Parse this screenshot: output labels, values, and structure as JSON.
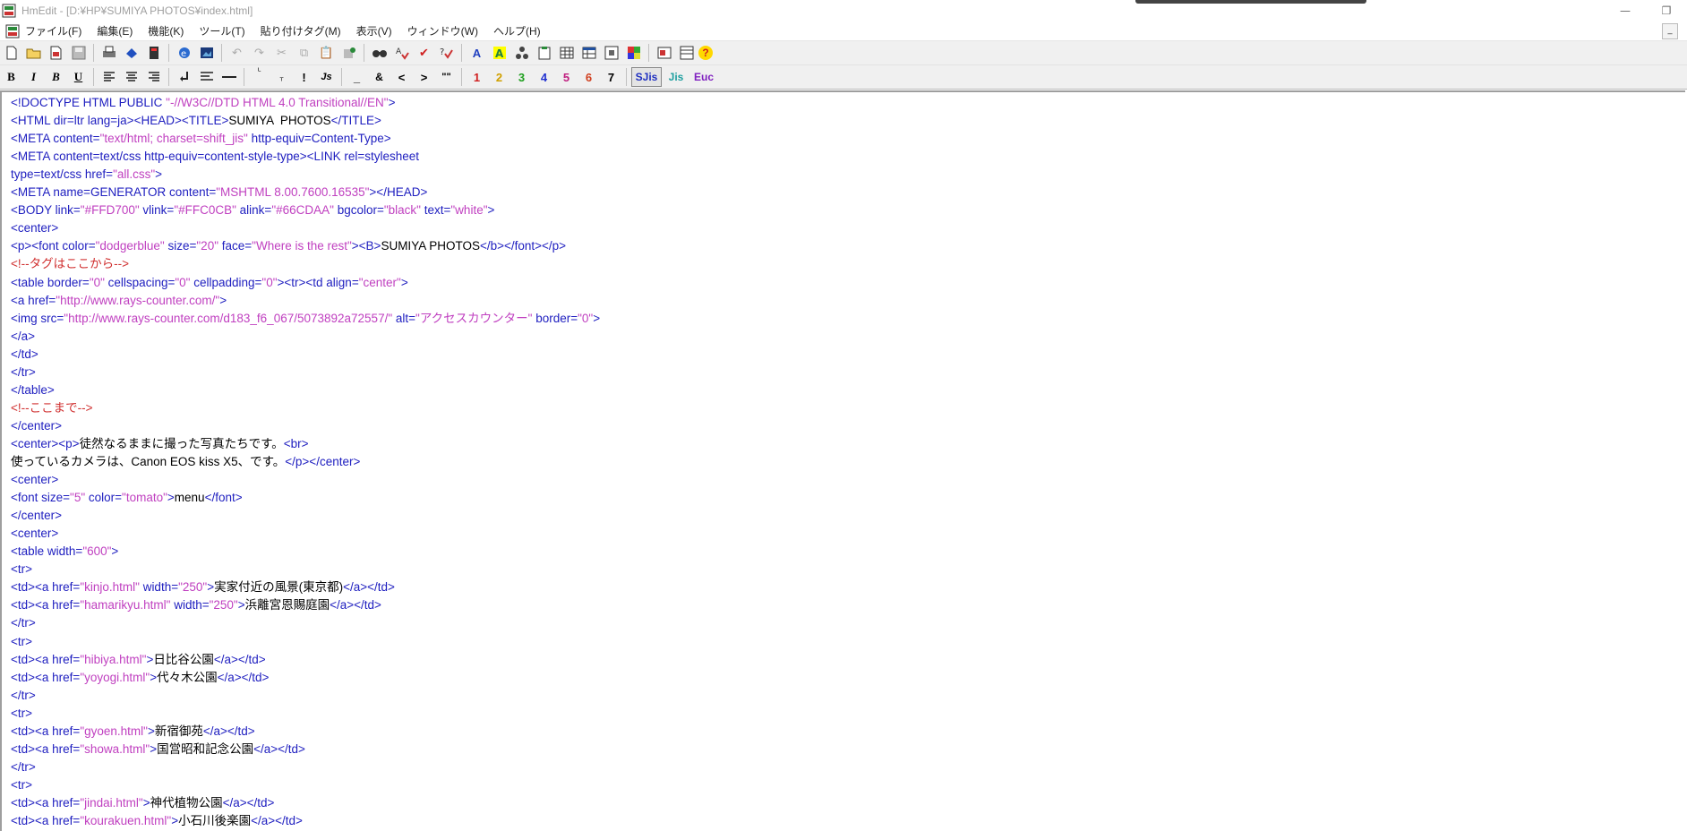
{
  "window": {
    "title": "HmEdit - [D:¥HP¥SUMIYA PHOTOS¥index.html]",
    "minimize": "—",
    "restore": "❐"
  },
  "menu": [
    "ファイル(F)",
    "編集(E)",
    "機能(K)",
    "ツール(T)",
    "貼り付けタグ(M)",
    "表示(V)",
    "ウィンドウ(W)",
    "ヘルプ(H)"
  ],
  "toolbar2": {
    "bold": "B",
    "italic": "I",
    "bold_italic": "B",
    "underline": "U",
    "js": "Js",
    "underscore": "_",
    "amp": "&",
    "lt": "<",
    "gt": ">",
    "quotes": "\"\"",
    "sizes": [
      "1",
      "2",
      "3",
      "4",
      "5",
      "6",
      "7"
    ],
    "encodings": [
      "SJis",
      "Jis",
      "Euc"
    ]
  },
  "colors": {
    "tag": "#2020c0",
    "string": "#c040c0",
    "comment": "#d03030",
    "size_colors": [
      "#d02020",
      "#d0a000",
      "#20a020",
      "#2030d0",
      "#c02080",
      "#d04020",
      "#000000"
    ]
  },
  "code_lines": [
    [
      {
        "t": "tag",
        "v": "<!DOCTYPE HTML PUBLIC "
      },
      {
        "t": "str",
        "v": "\"-//W3C//DTD HTML 4.0 Transitional//EN\""
      },
      {
        "t": "tag",
        "v": ">"
      }
    ],
    [
      {
        "t": "tag",
        "v": "<HTML dir=ltr lang=ja><HEAD><TITLE>"
      },
      {
        "t": "txt",
        "v": "SUMIYA  PHOTOS"
      },
      {
        "t": "tag",
        "v": "</TITLE>"
      }
    ],
    [
      {
        "t": "tag",
        "v": "<META content="
      },
      {
        "t": "str",
        "v": "\"text/html; charset=shift_jis\""
      },
      {
        "t": "tag",
        "v": " http-equiv=Content-Type>"
      }
    ],
    [
      {
        "t": "tag",
        "v": "<META content=text/css http-equiv=content-style-type><LINK rel=stylesheet"
      }
    ],
    [
      {
        "t": "tag",
        "v": "type=text/css href="
      },
      {
        "t": "str",
        "v": "\"all.css\""
      },
      {
        "t": "tag",
        "v": ">"
      }
    ],
    [
      {
        "t": "tag",
        "v": "<META name=GENERATOR content="
      },
      {
        "t": "str",
        "v": "\"MSHTML 8.00.7600.16535\""
      },
      {
        "t": "tag",
        "v": "></HEAD>"
      }
    ],
    [
      {
        "t": "tag",
        "v": "<BODY link="
      },
      {
        "t": "str",
        "v": "\"#FFD700\""
      },
      {
        "t": "tag",
        "v": " vlink="
      },
      {
        "t": "str",
        "v": "\"#FFC0CB\""
      },
      {
        "t": "tag",
        "v": " alink="
      },
      {
        "t": "str",
        "v": "\"#66CDAA\""
      },
      {
        "t": "tag",
        "v": " bgcolor="
      },
      {
        "t": "str",
        "v": "\"black\""
      },
      {
        "t": "tag",
        "v": " text="
      },
      {
        "t": "str",
        "v": "\"white\""
      },
      {
        "t": "tag",
        "v": ">"
      }
    ],
    [
      {
        "t": "tag",
        "v": "<center>"
      }
    ],
    [
      {
        "t": "tag",
        "v": "<p><font color="
      },
      {
        "t": "str",
        "v": "\"dodgerblue\""
      },
      {
        "t": "tag",
        "v": " size="
      },
      {
        "t": "str",
        "v": "\"20\""
      },
      {
        "t": "tag",
        "v": " face="
      },
      {
        "t": "str",
        "v": "\"Where is the rest\""
      },
      {
        "t": "tag",
        "v": "><B>"
      },
      {
        "t": "txt",
        "v": "SUMIYA PHOTOS"
      },
      {
        "t": "tag",
        "v": "</b></font></p>"
      }
    ],
    [
      {
        "t": "cmt",
        "v": "<!--タグはここから-->"
      }
    ],
    [
      {
        "t": "tag",
        "v": "<table border="
      },
      {
        "t": "str",
        "v": "\"0\""
      },
      {
        "t": "tag",
        "v": " cellspacing="
      },
      {
        "t": "str",
        "v": "\"0\""
      },
      {
        "t": "tag",
        "v": " cellpadding="
      },
      {
        "t": "str",
        "v": "\"0\""
      },
      {
        "t": "tag",
        "v": "><tr><td align="
      },
      {
        "t": "str",
        "v": "\"center\""
      },
      {
        "t": "tag",
        "v": ">"
      }
    ],
    [
      {
        "t": "tag",
        "v": "<a href="
      },
      {
        "t": "str",
        "v": "\"http://www.rays-counter.com/\""
      },
      {
        "t": "tag",
        "v": ">"
      }
    ],
    [
      {
        "t": "tag",
        "v": "<img src="
      },
      {
        "t": "str",
        "v": "\"http://www.rays-counter.com/d183_f6_067/5073892a72557/\""
      },
      {
        "t": "tag",
        "v": " alt="
      },
      {
        "t": "str",
        "v": "\"アクセスカウンター\""
      },
      {
        "t": "tag",
        "v": " border="
      },
      {
        "t": "str",
        "v": "\"0\""
      },
      {
        "t": "tag",
        "v": ">"
      }
    ],
    [
      {
        "t": "tag",
        "v": "</a>"
      }
    ],
    [
      {
        "t": "tag",
        "v": "</td>"
      }
    ],
    [
      {
        "t": "tag",
        "v": "</tr>"
      }
    ],
    [
      {
        "t": "tag",
        "v": "</table>"
      }
    ],
    [
      {
        "t": "cmt",
        "v": "<!--ここまで-->"
      }
    ],
    [
      {
        "t": "tag",
        "v": "</center>"
      }
    ],
    [
      {
        "t": "tag",
        "v": "<center><p>"
      },
      {
        "t": "txt",
        "v": "徒然なるままに撮った写真たちです。"
      },
      {
        "t": "tag",
        "v": "<br>"
      }
    ],
    [
      {
        "t": "txt",
        "v": "使っているカメラは、Canon EOS kiss X5、です。"
      },
      {
        "t": "tag",
        "v": "</p></center>"
      }
    ],
    [
      {
        "t": "tag",
        "v": "<center>"
      }
    ],
    [
      {
        "t": "tag",
        "v": "<font size="
      },
      {
        "t": "str",
        "v": "\"5\""
      },
      {
        "t": "tag",
        "v": " color="
      },
      {
        "t": "str",
        "v": "\"tomato\""
      },
      {
        "t": "tag",
        "v": ">"
      },
      {
        "t": "txt",
        "v": "menu"
      },
      {
        "t": "tag",
        "v": "</font>"
      }
    ],
    [
      {
        "t": "tag",
        "v": "</center>"
      }
    ],
    [
      {
        "t": "tag",
        "v": "<center>"
      }
    ],
    [
      {
        "t": "tag",
        "v": "<table width="
      },
      {
        "t": "str",
        "v": "\"600\""
      },
      {
        "t": "tag",
        "v": ">"
      }
    ],
    [
      {
        "t": "tag",
        "v": "<tr>"
      }
    ],
    [
      {
        "t": "tag",
        "v": "<td><a href="
      },
      {
        "t": "str",
        "v": "\"kinjo.html\""
      },
      {
        "t": "tag",
        "v": " width="
      },
      {
        "t": "str",
        "v": "\"250\""
      },
      {
        "t": "tag",
        "v": ">"
      },
      {
        "t": "txt",
        "v": "実家付近の風景(東京都)"
      },
      {
        "t": "tag",
        "v": "</a></td>"
      }
    ],
    [
      {
        "t": "tag",
        "v": "<td><a href="
      },
      {
        "t": "str",
        "v": "\"hamarikyu.html\""
      },
      {
        "t": "tag",
        "v": " width="
      },
      {
        "t": "str",
        "v": "\"250\""
      },
      {
        "t": "tag",
        "v": ">"
      },
      {
        "t": "txt",
        "v": "浜離宮恩賜庭園"
      },
      {
        "t": "tag",
        "v": "</a></td>"
      }
    ],
    [
      {
        "t": "tag",
        "v": "</tr>"
      }
    ],
    [
      {
        "t": "tag",
        "v": "<tr>"
      }
    ],
    [
      {
        "t": "tag",
        "v": "<td><a href="
      },
      {
        "t": "str",
        "v": "\"hibiya.html\""
      },
      {
        "t": "tag",
        "v": ">"
      },
      {
        "t": "txt",
        "v": "日比谷公園"
      },
      {
        "t": "tag",
        "v": "</a></td>"
      }
    ],
    [
      {
        "t": "tag",
        "v": "<td><a href="
      },
      {
        "t": "str",
        "v": "\"yoyogi.html\""
      },
      {
        "t": "tag",
        "v": ">"
      },
      {
        "t": "txt",
        "v": "代々木公園"
      },
      {
        "t": "tag",
        "v": "</a></td>"
      }
    ],
    [
      {
        "t": "tag",
        "v": "</tr>"
      }
    ],
    [
      {
        "t": "tag",
        "v": "<tr>"
      }
    ],
    [
      {
        "t": "tag",
        "v": "<td><a href="
      },
      {
        "t": "str",
        "v": "\"gyoen.html\""
      },
      {
        "t": "tag",
        "v": ">"
      },
      {
        "t": "txt",
        "v": "新宿御苑"
      },
      {
        "t": "tag",
        "v": "</a></td>"
      }
    ],
    [
      {
        "t": "tag",
        "v": "<td><a href="
      },
      {
        "t": "str",
        "v": "\"showa.html\""
      },
      {
        "t": "tag",
        "v": ">"
      },
      {
        "t": "txt",
        "v": "国営昭和記念公園"
      },
      {
        "t": "tag",
        "v": "</a></td>"
      }
    ],
    [
      {
        "t": "tag",
        "v": "</tr>"
      }
    ],
    [
      {
        "t": "tag",
        "v": "<tr>"
      }
    ],
    [
      {
        "t": "tag",
        "v": "<td><a href="
      },
      {
        "t": "str",
        "v": "\"jindai.html\""
      },
      {
        "t": "tag",
        "v": ">"
      },
      {
        "t": "txt",
        "v": "神代植物公園"
      },
      {
        "t": "tag",
        "v": "</a></td>"
      }
    ],
    [
      {
        "t": "tag",
        "v": "<td><a href="
      },
      {
        "t": "str",
        "v": "\"kourakuen.html\""
      },
      {
        "t": "tag",
        "v": ">"
      },
      {
        "t": "txt",
        "v": "小石川後楽園"
      },
      {
        "t": "tag",
        "v": "</a></td>"
      }
    ]
  ]
}
